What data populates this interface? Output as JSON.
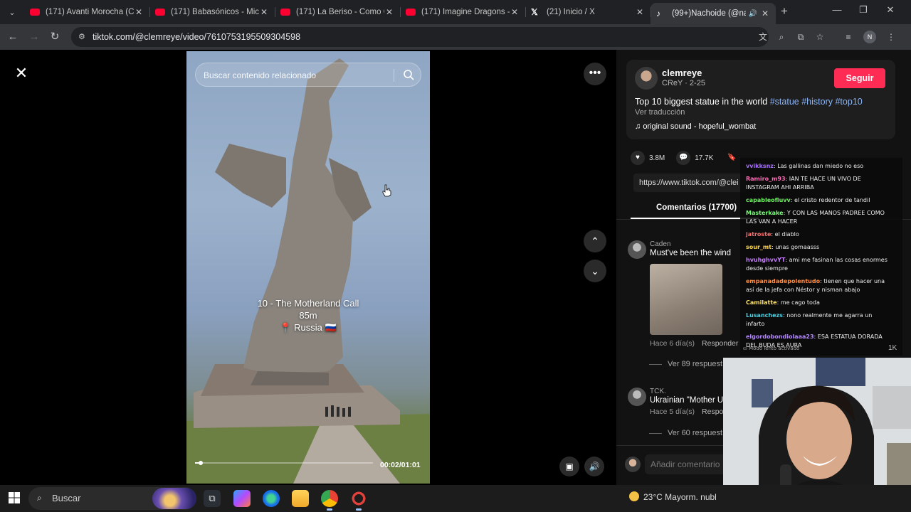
{
  "browser": {
    "tabs": [
      {
        "title": "(171) Avanti Morocha (CAE",
        "icon": "youtube-icon"
      },
      {
        "title": "(171) Babasónicos - Micro",
        "icon": "youtube-icon"
      },
      {
        "title": "(171) La Beriso - Como Ol",
        "icon": "youtube-icon"
      },
      {
        "title": "(171) Imagine Dragons - R",
        "icon": "youtube-icon"
      },
      {
        "title": "(21) Inicio / X",
        "icon": "x-icon"
      },
      {
        "title": "(99+)Nachoide (@nach",
        "icon": "tiktok-icon",
        "active": true
      }
    ],
    "url": "tiktok.com/@clemreye/video/7610753195509304598",
    "profile_initial": "N"
  },
  "video": {
    "search_placeholder": "Buscar contenido relacionado",
    "caption_line1": "10 - The Motherland Call",
    "caption_line2": "85m",
    "caption_line3": "📍 Russia 🇷🇺",
    "time": "00:02/01:01",
    "progress_fraction": 0.033
  },
  "post": {
    "username": "clemreye",
    "subline": "CReY · 2-25",
    "follow_label": "Seguir",
    "description": "Top 10 biggest statue in the world",
    "hashtags": [
      "#statue",
      "#history",
      "#top10"
    ],
    "translate": "Ver traducción",
    "sound": "original sound - hopeful_wombat",
    "likes": "3.8M",
    "comments_count": "17.7K",
    "share_url": "https://www.tiktok.com/@clei",
    "comments_tab": "Comentarios (17700)"
  },
  "comments": [
    {
      "name": "Caden",
      "text": "Must've been the wind",
      "meta": "Hace 6 día(s)",
      "reply": "Responder",
      "more": "Ver 89 respuest"
    },
    {
      "name": "TCK.",
      "text": "Ukrainian \"Mother U",
      "meta": "Hace 5 día(s)",
      "reply": "Respon",
      "more": "Ver 60 respuest"
    }
  ],
  "add_comment_placeholder": "Añadir comentario",
  "chat": {
    "messages": [
      {
        "name": "vvikksnz",
        "text": "Las gallinas dan miedo no eso",
        "color": "#a970ff"
      },
      {
        "name": "Ramiro_m93",
        "text": "IAN TE HACE UN VIVO DE INSTAGRAM AHI ARRIBA",
        "color": "#ff69b4"
      },
      {
        "name": "capableofluvv",
        "text": "el cristo redentor de tandil",
        "color": "#6cf060"
      },
      {
        "name": "Masterkake",
        "text": "Y CON LAS MANOS PADREE COMO LAS VAN A HACER",
        "color": "#7cfc7c"
      },
      {
        "name": "jatroste",
        "text": "el diablo",
        "color": "#ff6b6b"
      },
      {
        "name": "sour_mt",
        "text": "unas gomaasss",
        "color": "#ffd54f"
      },
      {
        "name": "hvuhghvvYT",
        "text": "ami me fasinan las cosas enormes desde siempre",
        "color": "#c77dff"
      },
      {
        "name": "empanadadepolentudo",
        "text": "tienen que hacer una así de la jefa con Néstor y nisman abajo",
        "color": "#ff8c42"
      },
      {
        "name": "Camilatte",
        "text": "me cago toda",
        "color": "#ffe066"
      },
      {
        "name": "Lusanchezs",
        "text": "nono realmente me agarra un infarto",
        "color": "#4dd0e1"
      },
      {
        "name": "elgordobondiolaaa23",
        "text": "ESA ESTATUA DORADA DEL BUDA ES AURA",
        "color": "#b388ff"
      }
    ],
    "footer": "Modo lento activado",
    "side_count": "1K"
  },
  "taskbar": {
    "search_label": "Buscar",
    "weather": "23°C  Mayorm. nubl"
  }
}
